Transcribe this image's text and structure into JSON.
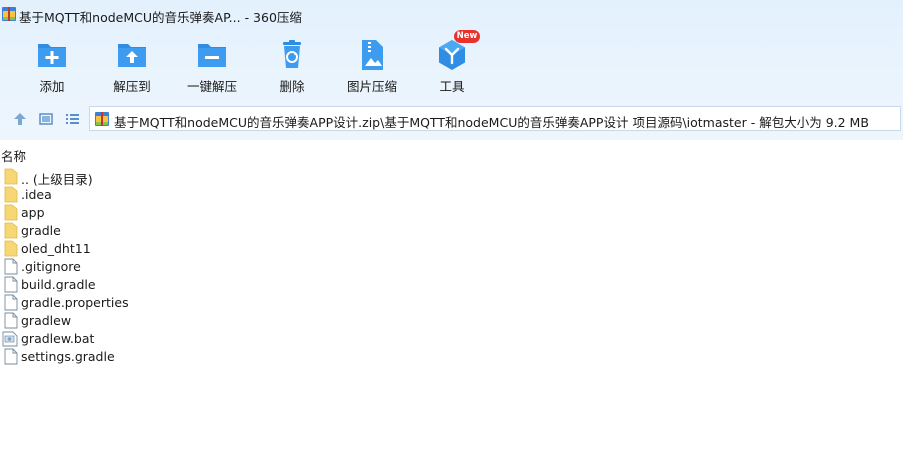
{
  "window": {
    "title": "基于MQTT和nodeMCU的音乐弹奏AP... - 360压缩"
  },
  "toolbar": {
    "add_label": "添加",
    "extract_to_label": "解压到",
    "one_click_extract_label": "一键解压",
    "delete_label": "删除",
    "image_compress_label": "图片压缩",
    "tools_label": "工具",
    "tools_badge": "New"
  },
  "address": {
    "path": "基于MQTT和nodeMCU的音乐弹奏APP设计.zip\\基于MQTT和nodeMCU的音乐弹奏APP设计 项目源码\\iotmaster - 解包大小为 9.2 MB"
  },
  "list": {
    "column_name": "名称",
    "items": [
      {
        "name": ".. (上级目录)",
        "type": "folder"
      },
      {
        "name": ".idea",
        "type": "folder"
      },
      {
        "name": "app",
        "type": "folder"
      },
      {
        "name": "gradle",
        "type": "folder"
      },
      {
        "name": "oled_dht11",
        "type": "folder"
      },
      {
        "name": ".gitignore",
        "type": "file"
      },
      {
        "name": "build.gradle",
        "type": "file"
      },
      {
        "name": "gradle.properties",
        "type": "file"
      },
      {
        "name": "gradlew",
        "type": "file"
      },
      {
        "name": "gradlew.bat",
        "type": "bat"
      },
      {
        "name": "settings.gradle",
        "type": "file"
      }
    ]
  },
  "colors": {
    "icon_blue": "#2f8de4",
    "folder_yellow": "#f7d774",
    "badge_red": "#e8332c",
    "toolbar_bg": "#e6f2fd"
  }
}
